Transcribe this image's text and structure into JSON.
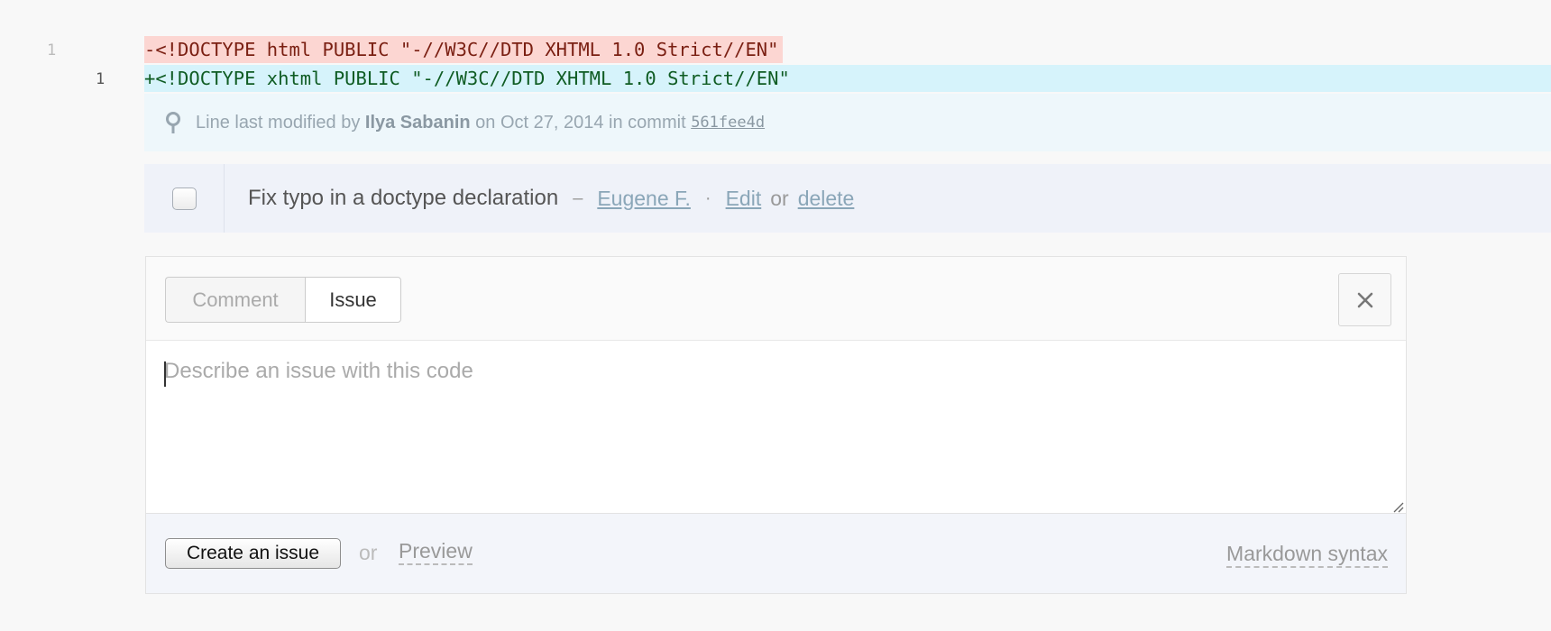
{
  "diff": {
    "old_line_number": "1",
    "new_line_number": "1",
    "removed_line": "-<!DOCTYPE html PUBLIC \"-//W3C//DTD XHTML 1.0 Strict//EN\"",
    "added_line": "+<!DOCTYPE xhtml PUBLIC \"-//W3C//DTD XHTML 1.0 Strict//EN\""
  },
  "blame": {
    "icon": "map-pin-icon",
    "prefix": "Line last modified by",
    "author": "Ilya Sabanin",
    "on_text": "on Oct 27, 2014 in commit",
    "commit": "561fee4d"
  },
  "issue": {
    "title": "Fix typo in a doctype declaration",
    "dash": "–",
    "author": "Eugene F.",
    "dot": "·",
    "edit_label": "Edit",
    "or_text": "or",
    "delete_label": "delete"
  },
  "form": {
    "tabs": [
      "Comment",
      "Issue"
    ],
    "active_tab": "Issue",
    "close_icon": "close-icon",
    "placeholder": "Describe an issue with this code",
    "value": "",
    "submit_label": "Create an issue",
    "or_text": "or",
    "preview_label": "Preview",
    "markdown_label": "Markdown syntax"
  },
  "colors": {
    "removed_bg": "#fcd6d2",
    "added_bg": "#d6f3fb",
    "blame_bg": "#eef7fb",
    "issue_bg": "#eff2f9"
  }
}
